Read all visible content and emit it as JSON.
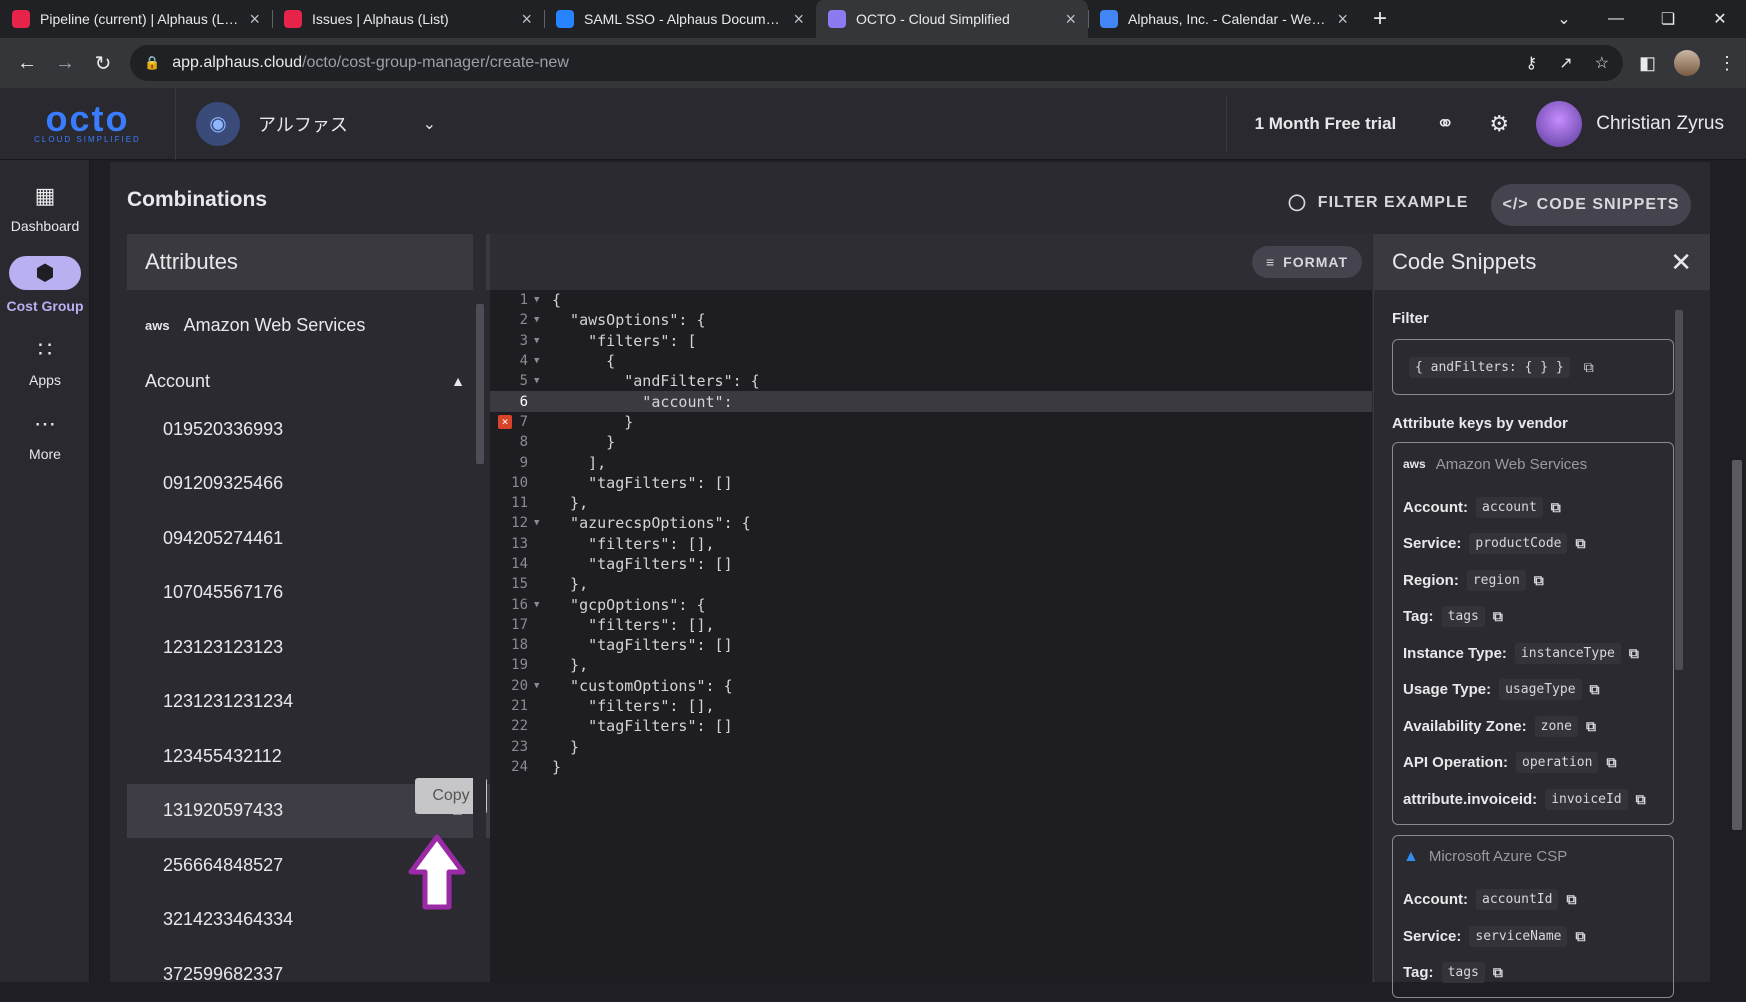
{
  "browser": {
    "tabs": [
      {
        "title": "Pipeline (current) | Alphaus (List)",
        "favicon": "clickup-icon",
        "active": false
      },
      {
        "title": "Issues | Alphaus (List)",
        "favicon": "clickup-icon",
        "active": false
      },
      {
        "title": "SAML SSO - Alphaus Documenta",
        "favicon": "confluence-icon",
        "active": false
      },
      {
        "title": "OCTO - Cloud Simplified",
        "favicon": "octo-icon",
        "active": true
      },
      {
        "title": "Alphaus, Inc. - Calendar - Week o",
        "favicon": "calendar-icon",
        "active": false
      }
    ],
    "url_host": "app.alphaus.cloud",
    "url_path": "/octo/cost-group-manager/create-new"
  },
  "header": {
    "logo_word": "octo",
    "logo_sub": "CLOUD SIMPLIFIED",
    "org_name": "アルファス",
    "trial": "1 Month Free trial",
    "user_name": "Christian Zyrus"
  },
  "sidenav": {
    "items": [
      {
        "label": "Dashboard",
        "icon": "dashboard-icon"
      },
      {
        "label": "Cost Group",
        "icon": "cube-icon",
        "active": true
      },
      {
        "label": "Apps",
        "icon": "apps-grid-icon"
      },
      {
        "label": "More",
        "icon": "more-dots-icon"
      }
    ]
  },
  "page": {
    "title": "Combinations",
    "filter_example": "FILTER EXAMPLE",
    "code_snippets_btn": "CODE SNIPPETS"
  },
  "attributes": {
    "title": "Attributes",
    "vendor": "Amazon Web Services",
    "vendor_logo": "aws",
    "group": "Account",
    "accounts": [
      "019520336993",
      "091209325466",
      "094205274461",
      "107045567176",
      "123123123123",
      "1231231231234",
      "123455432112",
      "131920597433",
      "256664848527",
      "3214233464334",
      "372599682337"
    ],
    "copy_tooltip": "Copy"
  },
  "editor": {
    "format_btn": "FORMAT",
    "lines": [
      "{",
      "  \"awsOptions\": {",
      "    \"filters\": [",
      "      {",
      "        \"andFilters\": {",
      "          \"account\":",
      "        }",
      "      }",
      "    ],",
      "    \"tagFilters\": []",
      "  },",
      "  \"azurecspOptions\": {",
      "    \"filters\": [],",
      "    \"tagFilters\": []",
      "  },",
      "  \"gcpOptions\": {",
      "    \"filters\": [],",
      "    \"tagFilters\": []",
      "  },",
      "  \"customOptions\": {",
      "    \"filters\": [],",
      "    \"tagFilters\": []",
      "  }",
      "}"
    ],
    "fold_lines": [
      1,
      2,
      3,
      4,
      5,
      12,
      16,
      20
    ],
    "current_line": 6,
    "error_line": 7
  },
  "snippets": {
    "title": "Code Snippets",
    "filter_label": "Filter",
    "filter_value": "{ andFilters: { } }",
    "keys_label": "Attribute keys by vendor",
    "vendors": [
      {
        "name": "Amazon Web Services",
        "logo": "aws",
        "keys": [
          {
            "label": "Account:",
            "key": "account"
          },
          {
            "label": "Service:",
            "key": "productCode"
          },
          {
            "label": "Region:",
            "key": "region"
          },
          {
            "label": "Tag:",
            "key": "tags"
          },
          {
            "label": "Instance Type:",
            "key": "instanceType"
          },
          {
            "label": "Usage Type:",
            "key": "usageType"
          },
          {
            "label": "Availability Zone:",
            "key": "zone"
          },
          {
            "label": "API Operation:",
            "key": "operation"
          },
          {
            "label": "attribute.invoiceid:",
            "key": "invoiceId"
          }
        ]
      },
      {
        "name": "Microsoft Azure CSP",
        "logo": "azure-icon",
        "keys": [
          {
            "label": "Account:",
            "key": "accountId"
          },
          {
            "label": "Service:",
            "key": "serviceName"
          },
          {
            "label": "Tag:",
            "key": "tags"
          }
        ]
      }
    ]
  },
  "colors": {
    "accent": "#b9b0f2",
    "logo": "#3a7cff",
    "error": "#d8432a",
    "annotation_arrow": "#9b2aa6"
  }
}
